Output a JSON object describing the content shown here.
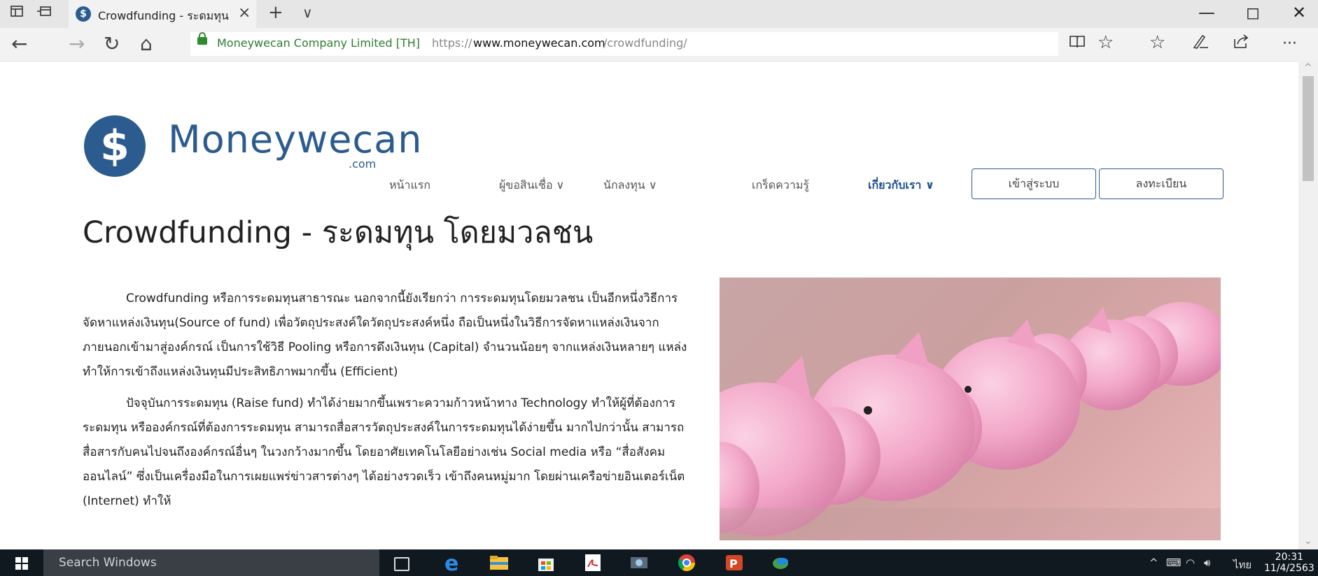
{
  "browser": {
    "tab_title": "Crowdfunding - ระดมทุน",
    "tab_close": "×",
    "new_tab": "+",
    "tab_menu": "∨",
    "win_min": "—",
    "win_max": "◻",
    "win_close": "✕",
    "site_identity": "Moneywecan Company Limited [TH]",
    "url_protocol": "https://",
    "url_host": "www.moneywecan.com",
    "url_path": "/crowdfunding/",
    "more_label": "···"
  },
  "site": {
    "logo_text": "Moneywecan",
    "logo_suffix": ".com",
    "nav": [
      {
        "label": "หน้าแรก"
      },
      {
        "label": "ผู้ขอสินเชื่อ ∨"
      },
      {
        "label": "นักลงทุน ∨"
      },
      {
        "label": "เกร็ดความรู้"
      },
      {
        "label": "เกี่ยวกับเรา ∨"
      }
    ],
    "login_label": "เข้าสู่ระบบ",
    "register_label": "ลงทะเบียน"
  },
  "page": {
    "title": "Crowdfunding - ระดมทุน โดยมวลชน",
    "paragraphs": [
      "Crowdfunding หรือการระดมทุนสาธารณะ นอกจากนี้ยังเรียกว่า การระดมทุนโดยมวลชน เป็นอีกหนึ่งวิธีการจัดหาแหล่งเงินทุน(Source of fund) เพื่อวัตถุประสงค์ใดวัตถุประสงค์หนึ่ง ถือเป็นหนึ่งในวิธีการจัดหาแหล่งเงินจากภายนอกเข้ามาสู่องค์กรณ์ เป็นการใช้วิธี Pooling หรือการดึงเงินทุน (Capital) จำนวนน้อยๆ จากแหล่งเงินหลายๆ แหล่ง ทำให้การเข้าถึงแหล่งเงินทุนมีประสิทธิภาพมากขึ้น (Efficient)",
      "ปัจจุบันการระดมทุน (Raise fund) ทำได้ง่ายมากขึ้นเพราะความก้าวหน้าทาง Technology ทำให้ผู้ที่ต้องการระดมทุน หรือองค์กรณ์ที่ต้องการระดมทุน สามารถสื่อสารวัตถุประสงค์ในการระดมทุนได้ง่ายขึ้น มากไปกว่านั้น สามารถสื่อสารกับคนไปจนถึงองค์กรณ์อื่นๆ ในวงกว้างมากขึ้น โดยอาศัยเทคโนโลยีอย่างเช่น Social media หรือ “สื่อสังคมออนไลน์” ซึ่งเป็นเครื่องมือในการเผยแพร่ข่าวสารต่างๆ ได้อย่างรวดเร็ว เข้าถึงคนหมู่มาก โดยผ่านเครือข่ายอินเตอร์เน็ต (Internet) ทำให้"
    ]
  },
  "taskbar": {
    "search_placeholder": "Search Windows",
    "lang": "ไทย",
    "time": "20:31",
    "date": "11/4/2563"
  },
  "colors": {
    "brand": "#2c5c8f",
    "identity_green": "#2e7d32",
    "pig_pink": "#f3a9c9"
  }
}
